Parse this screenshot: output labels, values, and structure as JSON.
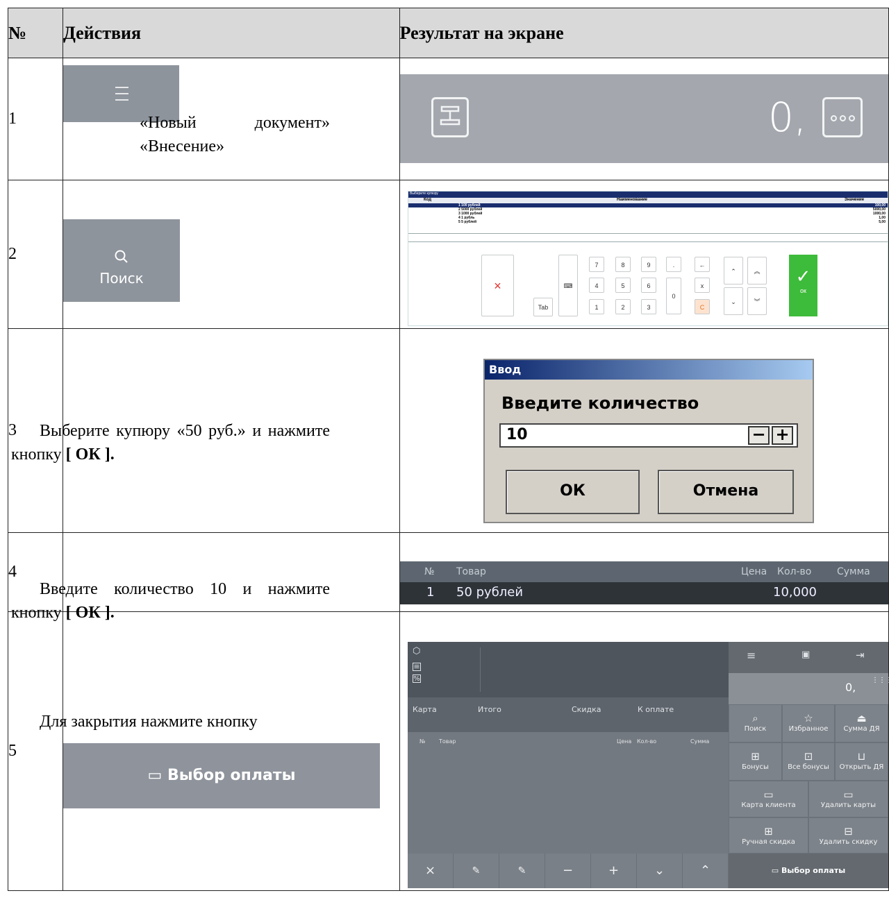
{
  "table": {
    "headers": {
      "num": "№",
      "actions": "Действия",
      "result": "Результат на экране"
    }
  },
  "rows": [
    {
      "num": "1",
      "text": "«Новый документ» «Внесение»",
      "screen": {
        "value": "0,"
      }
    },
    {
      "num": "2",
      "button_label": "Поиск",
      "screen": {
        "title": "Выберите купюру",
        "columns": [
          "Код",
          "Наименование",
          "Значение"
        ],
        "items": [
          {
            "name": "1 100 рублей",
            "value": "100,00"
          },
          {
            "name": "2 5000 рублей",
            "value": "5000,00"
          },
          {
            "name": "3 1000 рублей",
            "value": "1000,00"
          },
          {
            "name": "4 1 рубль",
            "value": "1,00"
          },
          {
            "name": "5 5 рублей",
            "value": "5,00"
          }
        ],
        "keys": {
          "digits": [
            "7",
            "8",
            "9",
            "4",
            "5",
            "6",
            "1",
            "2",
            "3"
          ],
          "zero": "0",
          "dot": ".",
          "tab": "Tab",
          "x": "x",
          "c": "C",
          "ok": "ок"
        }
      }
    },
    {
      "num": "3",
      "text_pre": "Выберите купюру «50 руб.» и нажмите кнопку ",
      "text_bold": "[ ОК ].",
      "screen": {
        "title": "Ввод",
        "prompt": "Введите количество",
        "input_value": "10",
        "minus": "−",
        "plus": "+",
        "ok_label": "ОК",
        "cancel_label": "Отмена"
      }
    },
    {
      "num": "4",
      "text_pre": "Введите количество 10 и нажмите кнопку ",
      "text_bold": "[ ОК ].",
      "screen": {
        "columns": {
          "num": "№",
          "item": "Товар",
          "price": "Цена",
          "qty": "Кол-во",
          "sum": "Сумма"
        },
        "row": {
          "num": "1",
          "item": "50 рублей",
          "qty": "10,000"
        }
      }
    },
    {
      "num": "5",
      "text": "Для закрытия нажмите кнопку",
      "button_label": "Выбор оплаты",
      "screen": {
        "summary_labels": [
          "Карта",
          "Итого",
          "Скидка",
          "К оплате"
        ],
        "columns": {
          "num": "№",
          "item": "Товар",
          "price": "Цена",
          "qty": "Кол-во",
          "sum": "Сумма"
        },
        "value": "0,",
        "buttons": [
          "Поиск",
          "Избранное",
          "Сумма ДЯ",
          "Бонусы",
          "Все бонусы",
          "Открыть ДЯ",
          "Карта клиента",
          "Удалить карты",
          "Ручная скидка",
          "Удалить скидку"
        ],
        "pay_label": "Выбор оплаты"
      }
    }
  ]
}
